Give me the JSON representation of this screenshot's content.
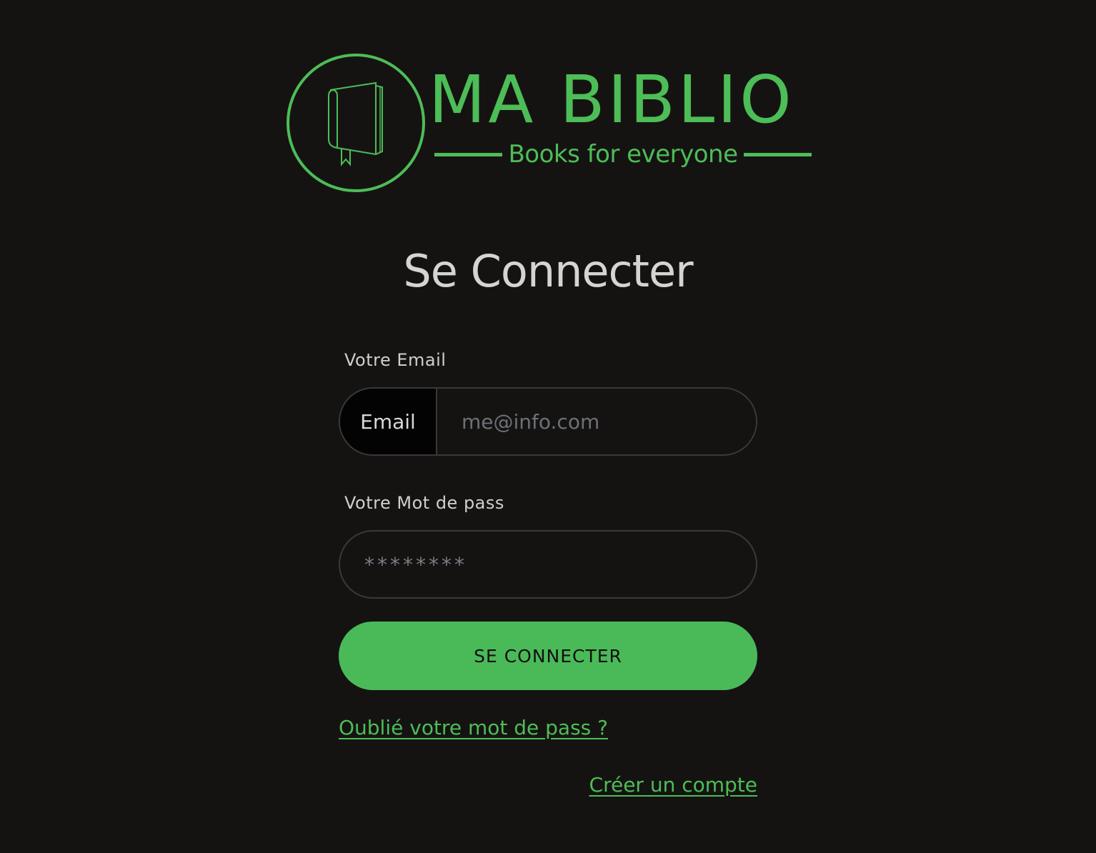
{
  "brand": {
    "title": "MA BIBLIO",
    "tagline": "Books for everyone",
    "logo_icon": "book-icon",
    "accent_color": "#4dbd57"
  },
  "page": {
    "heading": "Se Connecter"
  },
  "form": {
    "email_label": "Votre Email",
    "email_addon": "Email",
    "email_placeholder": "me@info.com",
    "password_label": "Votre Mot de pass",
    "password_placeholder": "********",
    "submit_label": "SE CONNECTER"
  },
  "links": {
    "forgot_password": "Oublié votre mot de pass ?",
    "create_account": "Créer un compte"
  },
  "colors": {
    "background": "#151312",
    "button": "#4aba58",
    "text": "#d0d0d0"
  }
}
